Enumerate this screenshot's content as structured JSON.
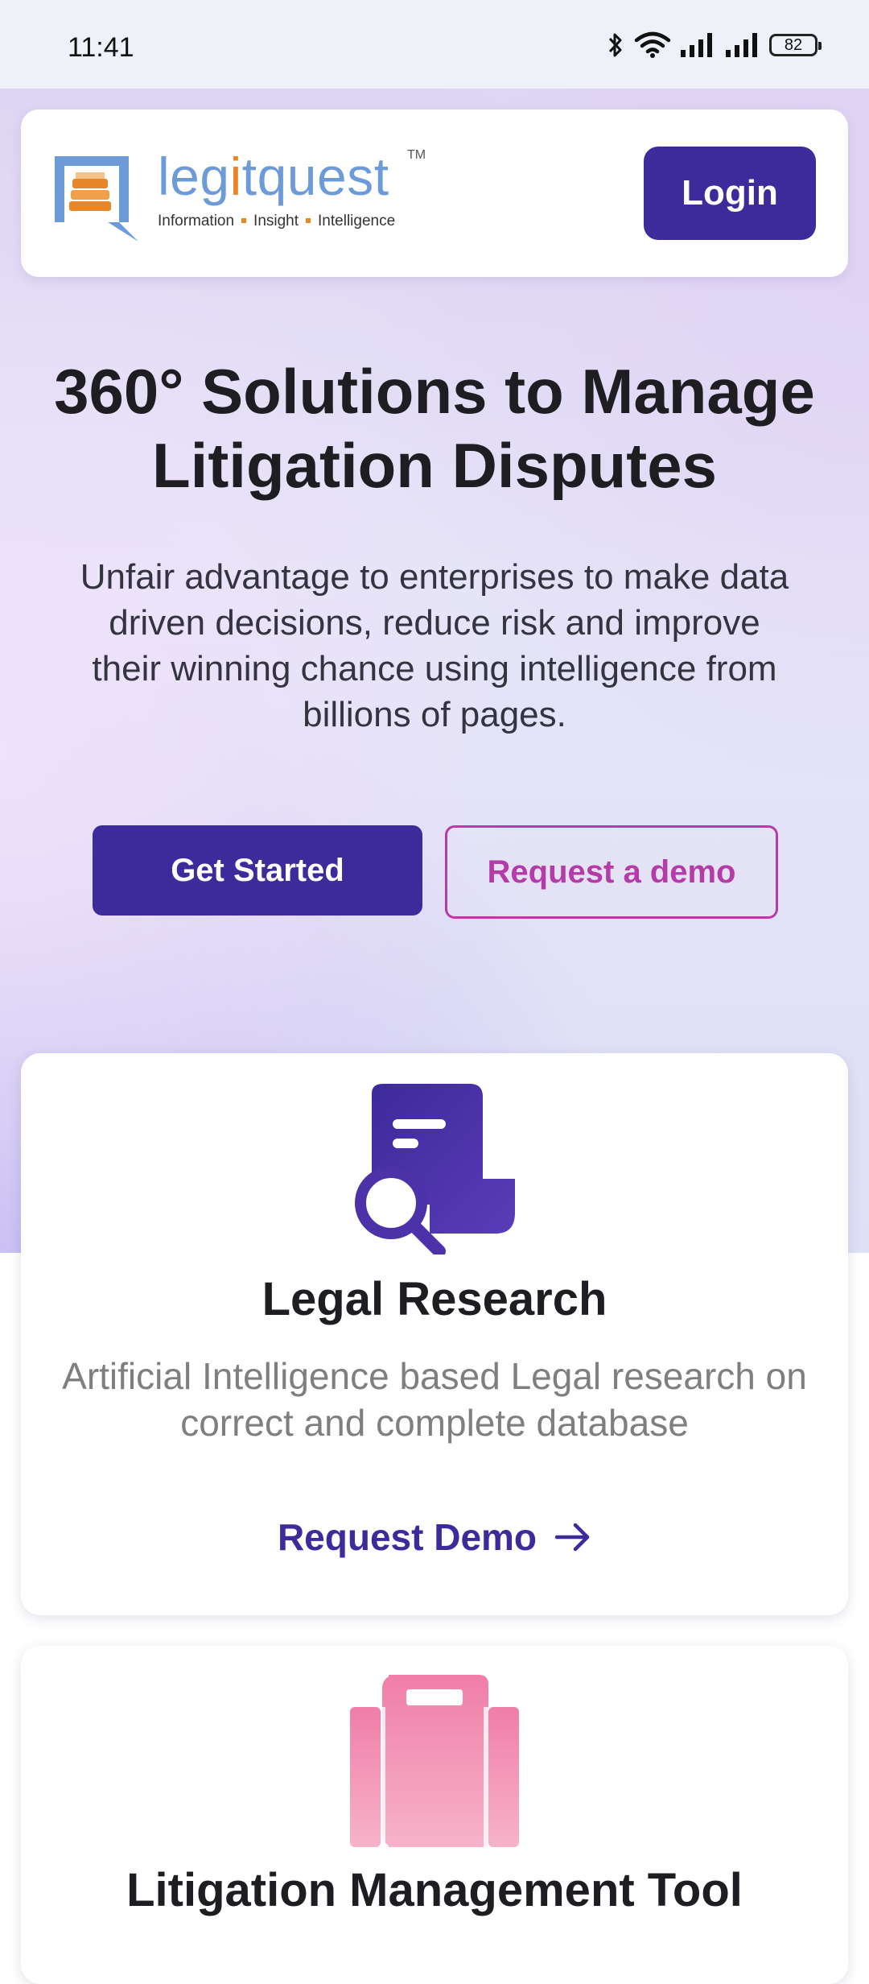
{
  "status_bar": {
    "time": "11:41",
    "battery": "82",
    "icons": [
      "bluetooth-icon",
      "wifi-icon",
      "signal-icon",
      "signal-icon",
      "battery-icon"
    ]
  },
  "header": {
    "brand_name_prefix": "leg",
    "brand_name_i": "i",
    "brand_name_suffix": "tquest",
    "brand_tm": "TM",
    "tagline_parts": [
      "Information",
      "Insight",
      "Intelligence"
    ],
    "login_label": "Login"
  },
  "hero": {
    "title": "360° Solutions to Manage Litigation Disputes",
    "subtitle": "Unfair advantage to enterprises to make data driven decisions, reduce risk and improve their winning chance using intelligence from billions of pages.",
    "get_started_label": "Get Started",
    "request_demo_label": "Request a demo"
  },
  "cards": [
    {
      "title": "Legal Research",
      "description": "Artificial Intelligence based Legal research on correct and complete database",
      "link_label": "Request Demo",
      "icon": "document-search-icon"
    },
    {
      "title": "Litigation Management Tool",
      "icon": "briefcase-icon"
    }
  ],
  "colors": {
    "primary": "#3d2a9b",
    "accent": "#b43ca9",
    "brand_blue": "#6d9bd8",
    "brand_orange": "#e8862a",
    "card2_icon": "#f38bb0"
  }
}
